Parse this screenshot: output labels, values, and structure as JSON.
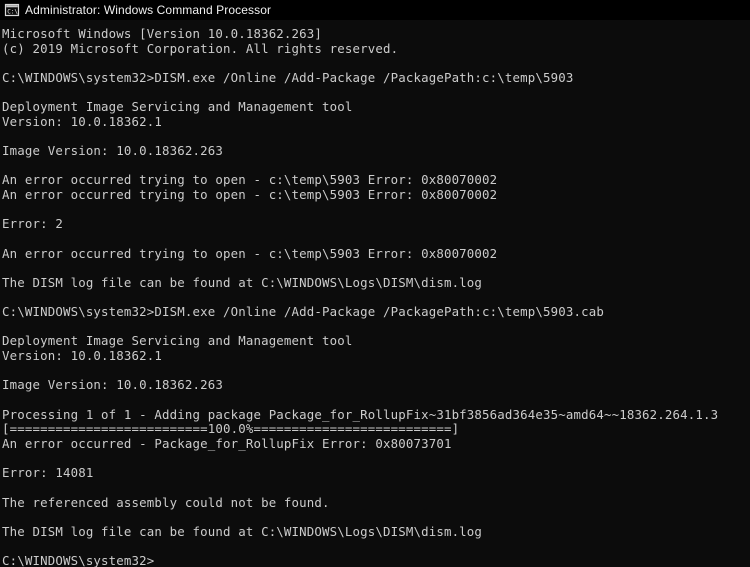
{
  "window": {
    "title": "Administrator: Windows Command Processor",
    "icon": "command-prompt-icon",
    "background_color": "#0c0c0c",
    "text_color": "#cccccc",
    "titlebar_color": "#000000",
    "titlebar_text_color": "#f0f0f0"
  },
  "console": {
    "prompt": "C:\\WINDOWS\\system32>",
    "lines": [
      "Microsoft Windows [Version 10.0.18362.263]",
      "(c) 2019 Microsoft Corporation. All rights reserved.",
      "",
      "C:\\WINDOWS\\system32>DISM.exe /Online /Add-Package /PackagePath:c:\\temp\\5903",
      "",
      "Deployment Image Servicing and Management tool",
      "Version: 10.0.18362.1",
      "",
      "Image Version: 10.0.18362.263",
      "",
      "An error occurred trying to open - c:\\temp\\5903 Error: 0x80070002",
      "An error occurred trying to open - c:\\temp\\5903 Error: 0x80070002",
      "",
      "Error: 2",
      "",
      "An error occurred trying to open - c:\\temp\\5903 Error: 0x80070002",
      "",
      "The DISM log file can be found at C:\\WINDOWS\\Logs\\DISM\\dism.log",
      "",
      "C:\\WINDOWS\\system32>DISM.exe /Online /Add-Package /PackagePath:c:\\temp\\5903.cab",
      "",
      "Deployment Image Servicing and Management tool",
      "Version: 10.0.18362.1",
      "",
      "Image Version: 10.0.18362.263",
      "",
      "Processing 1 of 1 - Adding package Package_for_RollupFix~31bf3856ad364e35~amd64~~18362.264.1.3",
      "[==========================100.0%==========================]",
      "An error occurred - Package_for_RollupFix Error: 0x80073701",
      "",
      "Error: 14081",
      "",
      "The referenced assembly could not be found.",
      "",
      "The DISM log file can be found at C:\\WINDOWS\\Logs\\DISM\\dism.log",
      "",
      "C:\\WINDOWS\\system32>"
    ]
  }
}
